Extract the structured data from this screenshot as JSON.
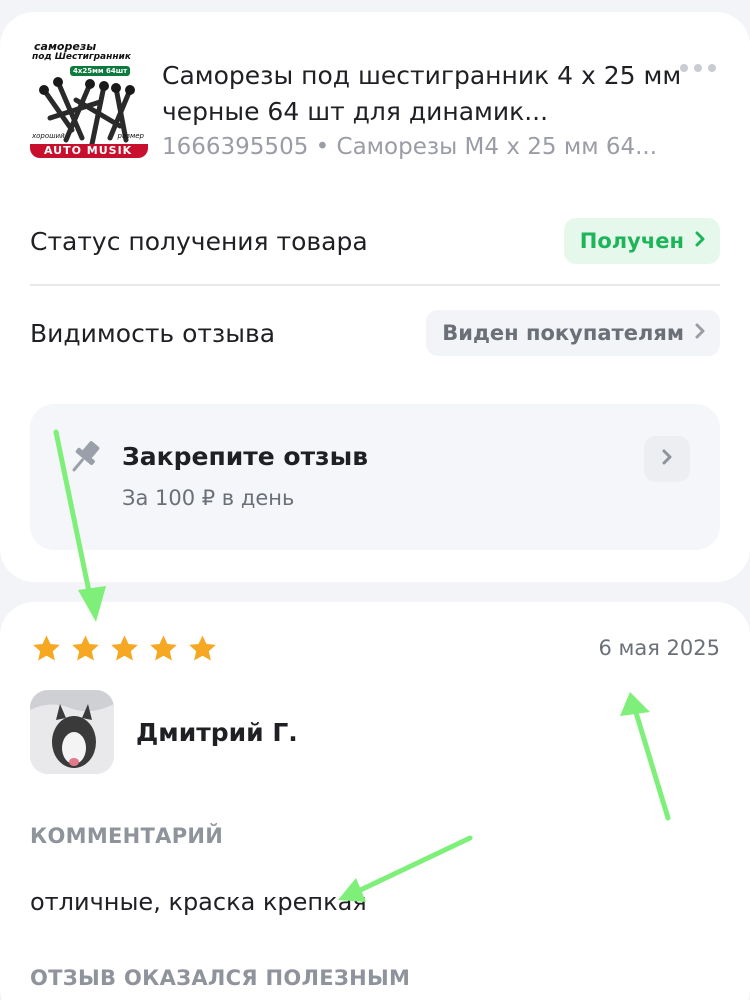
{
  "product": {
    "thumb_text_top": "саморезы",
    "thumb_text_mid": "под Шестигранник",
    "thumb_text_badge": "4x25мм 64шт",
    "thumb_text_left": "хороший",
    "thumb_text_right": "размер",
    "thumb_text_bottom": "AUTO MUSIK",
    "title": "Саморезы под шестигранник 4 х 25 мм черные 64 шт для динамик...",
    "subtitle": "1666395505 • Саморезы М4 х 25 мм 64..."
  },
  "status": {
    "label": "Статус получения товара",
    "value": "Получен"
  },
  "visibility": {
    "label": "Видимость отзыва",
    "value": "Виден покупателям"
  },
  "pin": {
    "title": "Закрепите отзыв",
    "subtitle": "За 100 ₽ в день"
  },
  "review": {
    "rating": 5,
    "date": "6 мая 2025",
    "author": "Дмитрий Г.",
    "comment_header": "КОММЕНТАРИЙ",
    "comment": "отличные, краска крепкая",
    "helpful_header": "ОТЗЫВ ОКАЗАЛСЯ ПОЛЕЗНЫМ"
  },
  "colors": {
    "accent_green": "#1db45a",
    "star": "#f7a823",
    "annotation_arrow": "#7ef07a"
  }
}
